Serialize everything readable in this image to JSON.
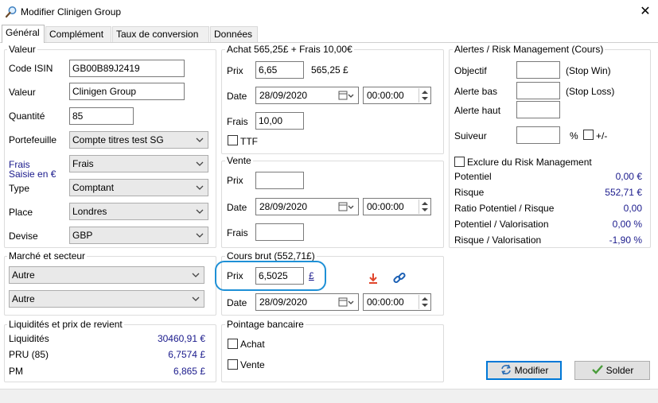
{
  "window": {
    "title": "Modifier Clinigen Group",
    "close_glyph": "✕"
  },
  "tabs": [
    {
      "label": "Général",
      "active": true
    },
    {
      "label": "Complément"
    },
    {
      "label": "Taux de conversion"
    },
    {
      "label": "Données"
    }
  ],
  "valeur_group": {
    "title": "Valeur",
    "isin_label": "Code ISIN",
    "isin_value": "GB00B89J2419",
    "valeur_label": "Valeur",
    "valeur_value": "Clinigen Group",
    "quantite_label": "Quantité",
    "quantite_value": "85",
    "portefeuille_label": "Portefeuille",
    "portefeuille_value": "Compte titres test SG",
    "frais_label_1": "Frais",
    "frais_label_2": "Saisie en €",
    "frais_value": "Frais",
    "type_label": "Type",
    "type_value": "Comptant",
    "place_label": "Place",
    "place_value": "Londres",
    "devise_label": "Devise",
    "devise_value": "GBP"
  },
  "marche_group": {
    "title": "Marché et secteur",
    "marche_value": "Autre",
    "secteur_value": "Autre"
  },
  "liquidites_group": {
    "title": "Liquidités et prix de revient",
    "rows": [
      {
        "label": "Liquidités",
        "value": "30460,91 €"
      },
      {
        "label": "PRU (85)",
        "value": "6,7574 £"
      },
      {
        "label": "PM",
        "value": "6,865 £"
      }
    ]
  },
  "achat_group": {
    "title": "Achat 565,25£ + Frais 10,00€",
    "prix_label": "Prix",
    "prix_value": "6,65",
    "prix_total": "565,25 £",
    "date_label": "Date",
    "date_value": "28/09/2020",
    "time_value": "00:00:00",
    "frais_label": "Frais",
    "frais_value": "10,00",
    "ttf_label": "TTF"
  },
  "vente_group": {
    "title": "Vente",
    "prix_label": "Prix",
    "prix_value": "",
    "date_label": "Date",
    "date_value": "28/09/2020",
    "time_value": "00:00:00",
    "frais_label": "Frais",
    "frais_value": ""
  },
  "cours_group": {
    "title": "Cours brut (552,71£)",
    "prix_label": "Prix",
    "prix_value": "6,5025",
    "currency_link": "£",
    "date_label": "Date",
    "date_value": "28/09/2020",
    "time_value": "00:00:00"
  },
  "pointage_group": {
    "title": "Pointage bancaire",
    "achat_label": "Achat",
    "vente_label": "Vente"
  },
  "alertes_group": {
    "title": "Alertes / Risk Management (Cours)",
    "objectif_label": "Objectif",
    "objectif_hint": "(Stop Win)",
    "alerte_bas_label": "Alerte bas",
    "alerte_bas_hint": "(Stop Loss)",
    "alerte_haut_label": "Alerte haut",
    "suiveur_label": "Suiveur",
    "suiveur_pct": "%",
    "suiveur_plusminus": "+/-",
    "exclure_label": "Exclure du Risk Management",
    "stats": [
      {
        "label": "Potentiel",
        "value": "0,00 €"
      },
      {
        "label": "Risque",
        "value": "552,71 €"
      },
      {
        "label": "Ratio Potentiel / Risque",
        "value": "0,00"
      },
      {
        "label": "Potentiel / Valorisation",
        "value": "0,00 %"
      },
      {
        "label": "Risque / Valorisation",
        "value": "-1,90 %"
      }
    ]
  },
  "buttons": {
    "modifier": "Modifier",
    "solder": "Solder"
  },
  "colors": {
    "accent": "#1e90d6",
    "value_text": "#1a1a8c",
    "download_icon": "#e0452b",
    "link_icon": "#1a5fb4"
  }
}
